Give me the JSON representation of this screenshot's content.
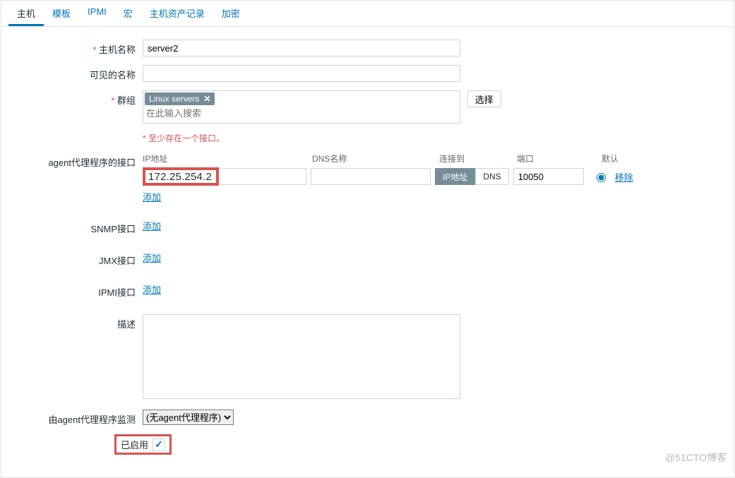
{
  "tabs": [
    "主机",
    "模板",
    "IPMI",
    "宏",
    "主机资产记录",
    "加密"
  ],
  "labels": {
    "hostname": "主机名称",
    "visible": "可见的名称",
    "groups": "群组",
    "select": "选择",
    "group_placeholder": "在此输入搜索",
    "group_tag": "Linux servers",
    "iface_note": "至少存在一个接口。",
    "agent_if": "agent代理程序的接口",
    "snmp_if": "SNMP接口",
    "jmx_if": "JMX接口",
    "ipmi_if": "IPMI接口",
    "desc": "描述",
    "monitored_by": "由agent代理程序监测",
    "enabled": "已启用"
  },
  "iface_cols": {
    "ip": "IP地址",
    "dns": "DNS名称",
    "conn": "连接到",
    "port": "端口",
    "def": "默认"
  },
  "values": {
    "hostname": "server2",
    "visible": "",
    "ip_highlight": "172.25.254.2",
    "dns": "",
    "conn_ip": "IP地址",
    "conn_dns": "DNS",
    "port": "10050",
    "proxy_option": "(无agent代理程序)"
  },
  "links": {
    "add": "添加",
    "remove": "移除"
  },
  "watermark": "@51CTO博客"
}
